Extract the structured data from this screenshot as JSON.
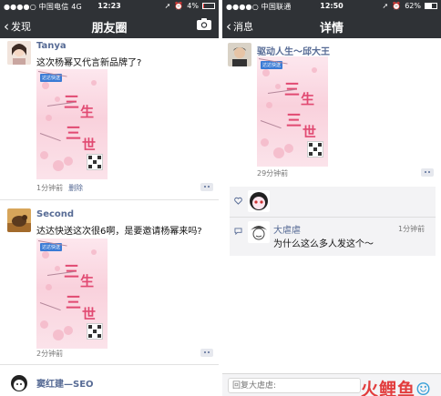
{
  "left": {
    "status": {
      "carrier": "●●●●○ 中国电信  4G",
      "time": "12:23",
      "battery": "4%",
      "battery_level": 0.04
    },
    "nav": {
      "back": "发现",
      "title": "朋友圈"
    },
    "posts": [
      {
        "name": "Tanya",
        "text": "这次杨幂又代言新品牌了?",
        "time": "1分钟前",
        "delete": "删除"
      },
      {
        "name": "Second",
        "text": "达达快送这次很6啊，是要邀请杨幂来吗?",
        "time": "2分钟前"
      },
      {
        "name": "窦红建—SEO"
      }
    ]
  },
  "right": {
    "status": {
      "carrier": "●●●●○ 中国联通",
      "time": "12:50",
      "battery": "62%",
      "battery_level": 0.62
    },
    "nav": {
      "back": "消息",
      "title": "详情"
    },
    "post": {
      "name": "驱动人生～邱大王",
      "time": "29分钟前"
    },
    "comment": {
      "name": "大虐虐",
      "text": "为什么这么多人发这个～",
      "time": "1分钟前"
    },
    "reply_placeholder": "回复大虐虐:",
    "watermark": "火鲤鱼"
  },
  "poster": {
    "brand": "达达快送",
    "title_chars": [
      "三",
      "生",
      "三",
      "世"
    ]
  }
}
